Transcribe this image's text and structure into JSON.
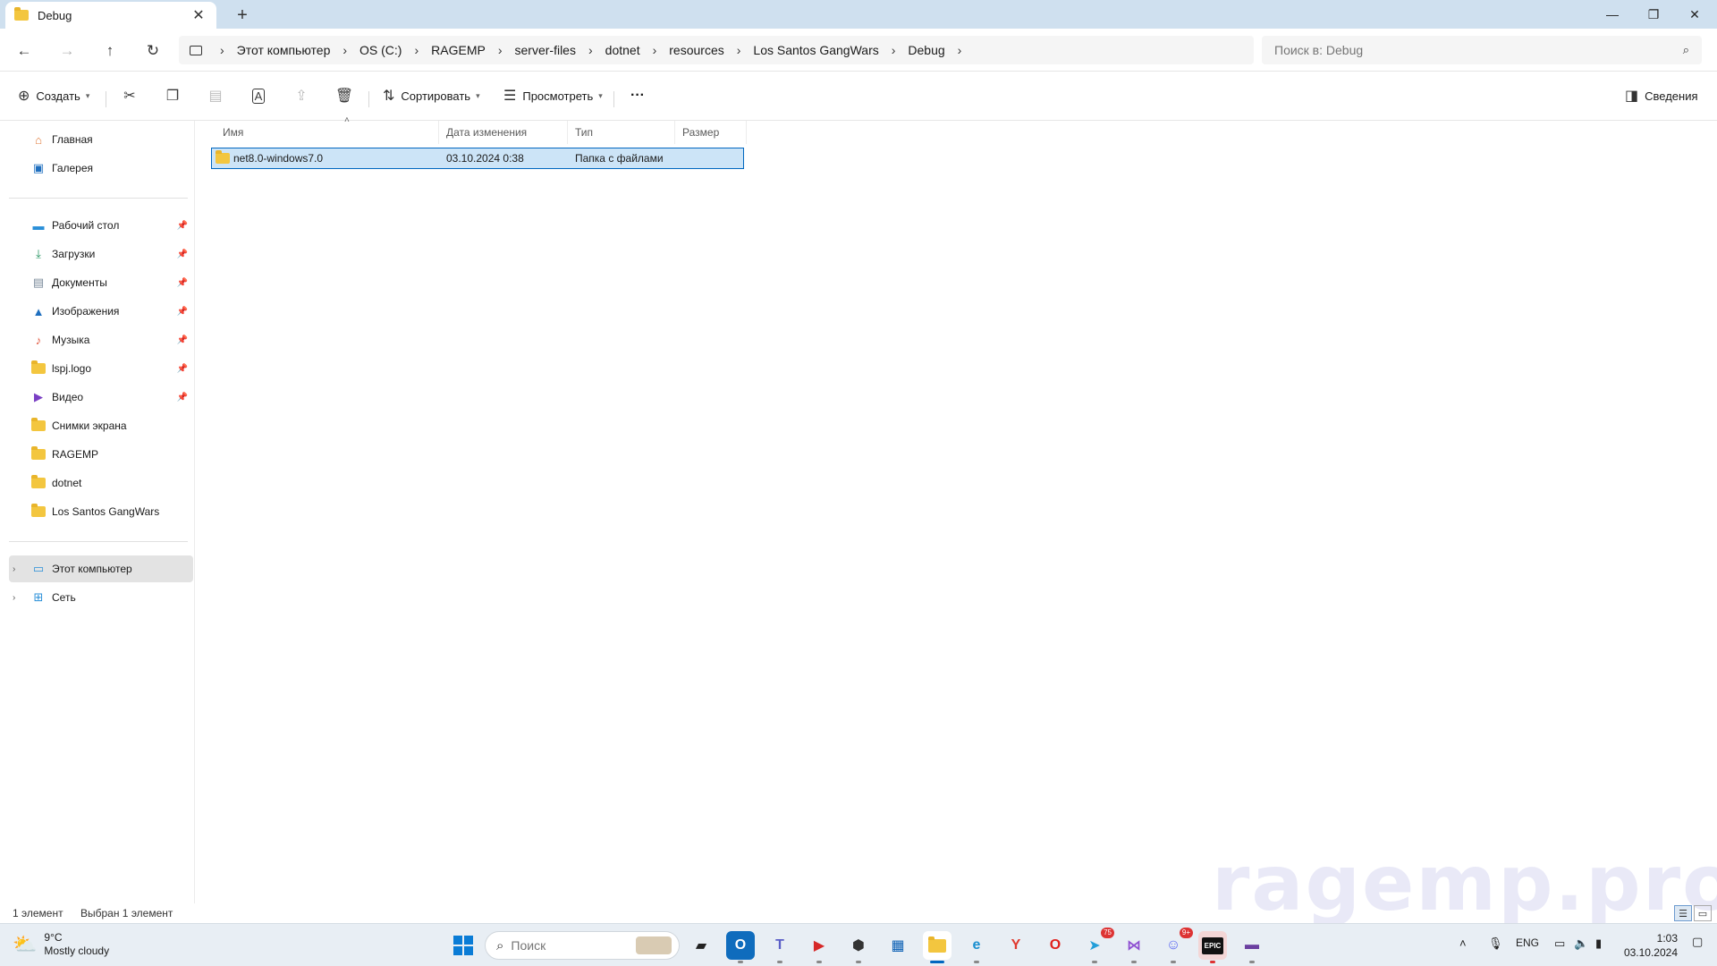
{
  "window": {
    "tab_title": "Debug",
    "tab_close": "✕",
    "new_tab": "+",
    "minimize": "—",
    "restore": "❐",
    "close": "✕"
  },
  "nav": {
    "breadcrumbs": [
      "Этот компьютер",
      "OS (C:)",
      "RAGEMP",
      "server-files",
      "dotnet",
      "resources",
      "Los Santos GangWars",
      "Debug"
    ],
    "search_placeholder": "Поиск в: Debug"
  },
  "toolbar": {
    "create_label": "Создать",
    "sort_label": "Сортировать",
    "view_label": "Просмотреть",
    "more_label": "···",
    "details_label": "Сведения"
  },
  "sidebar": {
    "home": "Главная",
    "gallery": "Галерея",
    "pinned": [
      {
        "label": "Рабочий стол",
        "icon": "desktop-icon"
      },
      {
        "label": "Загрузки",
        "icon": "download-icon"
      },
      {
        "label": "Документы",
        "icon": "documents-icon"
      },
      {
        "label": "Изображения",
        "icon": "pictures-icon"
      },
      {
        "label": "Музыка",
        "icon": "music-icon"
      },
      {
        "label": "lspj.logo",
        "icon": "folder-icon"
      },
      {
        "label": "Видео",
        "icon": "video-icon"
      }
    ],
    "recent": [
      "Снимки экрана",
      "RAGEMP",
      "dotnet",
      "Los Santos GangWars"
    ],
    "this_pc": "Этот компьютер",
    "network": "Сеть"
  },
  "filelist": {
    "columns": [
      "Имя",
      "Дата изменения",
      "Тип",
      "Размер"
    ],
    "rows": [
      {
        "name": "net8.0-windows7.0",
        "date": "03.10.2024 0:38",
        "type": "Папка с файлами",
        "size": ""
      }
    ]
  },
  "status": {
    "count": "1 элемент",
    "selected": "Выбран 1 элемент"
  },
  "watermark": "ragemp.pro",
  "taskbar": {
    "temperature": "9°C",
    "weather": "Mostly cloudy",
    "search_placeholder": "Поиск",
    "language": "ENG",
    "time": "1:03",
    "date": "03.10.2024",
    "telegram_badge": "75",
    "discord_badge": "9+",
    "epic_label": "EPIC"
  },
  "colors": {
    "titlebar": "#cfe0ef",
    "selection": "#cce4f7",
    "accent": "#0067c0",
    "folder": "#f3c63f"
  }
}
